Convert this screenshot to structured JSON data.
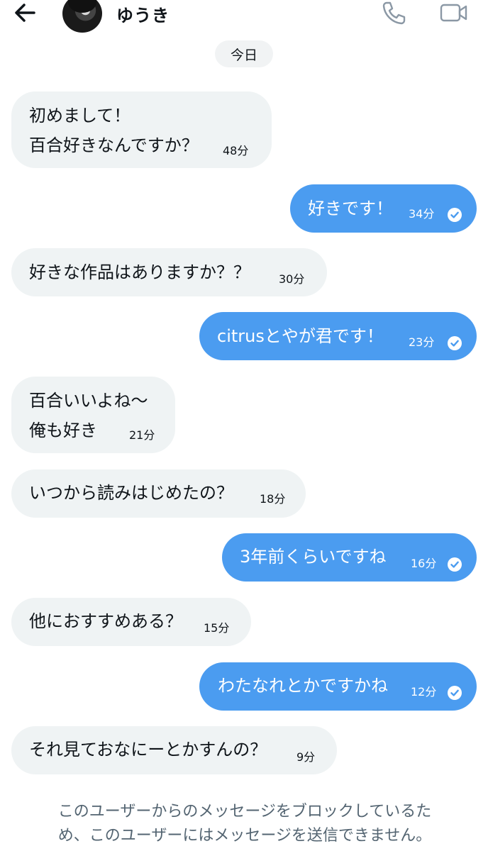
{
  "header": {
    "username": "ゆうき",
    "icons": [
      "back-arrow-icon",
      "avatar",
      "phone-icon",
      "video-camera-icon"
    ]
  },
  "date_label": "今日",
  "messages": [
    {
      "direction": "in",
      "lines": [
        "初めまして！",
        "百合好きなんですか？"
      ],
      "time": "48分"
    },
    {
      "direction": "out",
      "lines": [
        "好きです！"
      ],
      "time": "34分",
      "read": true
    },
    {
      "direction": "in",
      "lines": [
        "好きな作品はありますか？？"
      ],
      "time": "30分"
    },
    {
      "direction": "out",
      "lines": [
        "citrusとやが君です！"
      ],
      "time": "23分",
      "read": true
    },
    {
      "direction": "in",
      "lines": [
        "百合いいよね〜",
        "俺も好き"
      ],
      "time": "21分"
    },
    {
      "direction": "in",
      "lines": [
        "いつから読みはじめたの？"
      ],
      "time": "18分"
    },
    {
      "direction": "out",
      "lines": [
        "3年前くらいですね"
      ],
      "time": "16分",
      "read": true
    },
    {
      "direction": "in",
      "lines": [
        "他におすすめある？"
      ],
      "time": "15分"
    },
    {
      "direction": "out",
      "lines": [
        "わたなれとかですかね"
      ],
      "time": "12分",
      "read": true
    },
    {
      "direction": "in",
      "lines": [
        "それ見ておなにーとかすんの？"
      ],
      "time": "9分"
    }
  ],
  "footer": {
    "notice_line1": "このユーザーからのメッセージをブロックしているた",
    "notice_line2": "め、このユーザーにはメッセージを送信できません。"
  },
  "colors": {
    "outgoing_bubble": "#4b9cf0",
    "incoming_bubble": "#eff3f4",
    "notice_text": "#536471"
  }
}
